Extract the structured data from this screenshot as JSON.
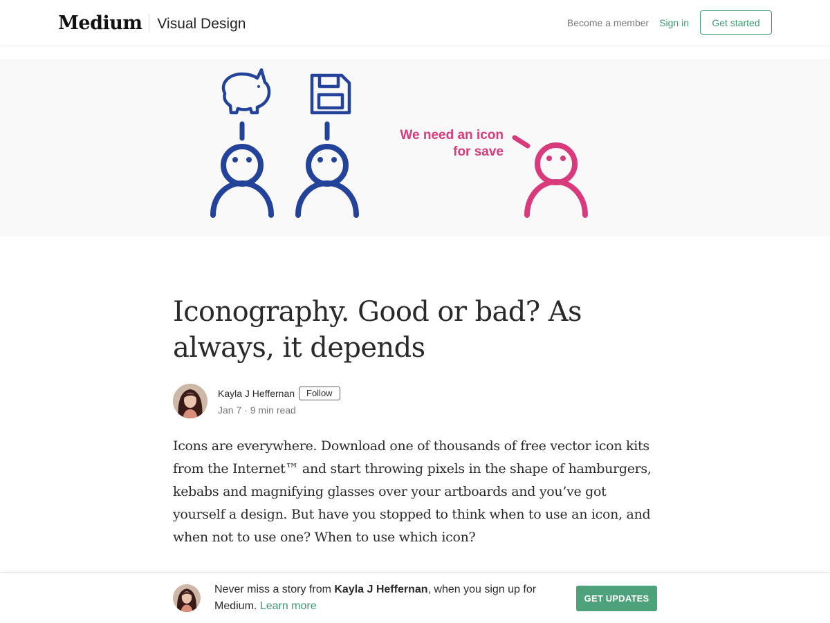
{
  "header": {
    "logo": "Medium",
    "publication": "Visual Design",
    "become_member": "Become a member",
    "sign_in": "Sign in",
    "get_started": "Get started"
  },
  "hero": {
    "speech_line1": "We need an icon",
    "speech_line2": "for save",
    "icons": [
      "piggy-bank-icon",
      "floppy-disk-icon"
    ],
    "colors": {
      "blue": "#23429a",
      "pink": "#d93a7b",
      "background": "#f9f9fa"
    }
  },
  "article": {
    "title": "Iconography. Good or bad? As always, it depends",
    "author": "Kayla J Heffernan",
    "follow_label": "Follow",
    "meta": "Jan 7 · 9 min read",
    "body": "Icons are everywhere. Download one of thousands of free vector icon kits from the Internet™ and start throwing pixels in the shape of hamburgers, kebabs and magnifying glasses over your artboards and you’ve got yourself a design. But have you stopped to think when to use an icon, and when not to use one? When to use which icon?"
  },
  "banner": {
    "prefix": "Never miss a story from ",
    "author": "Kayla J Heffernan",
    "suffix": ", when you sign up for Medium. ",
    "learn_more": "Learn more",
    "cta": "GET UPDATES"
  },
  "colors": {
    "accent": "#3d9a6f",
    "cta_bg": "#4da27c"
  }
}
